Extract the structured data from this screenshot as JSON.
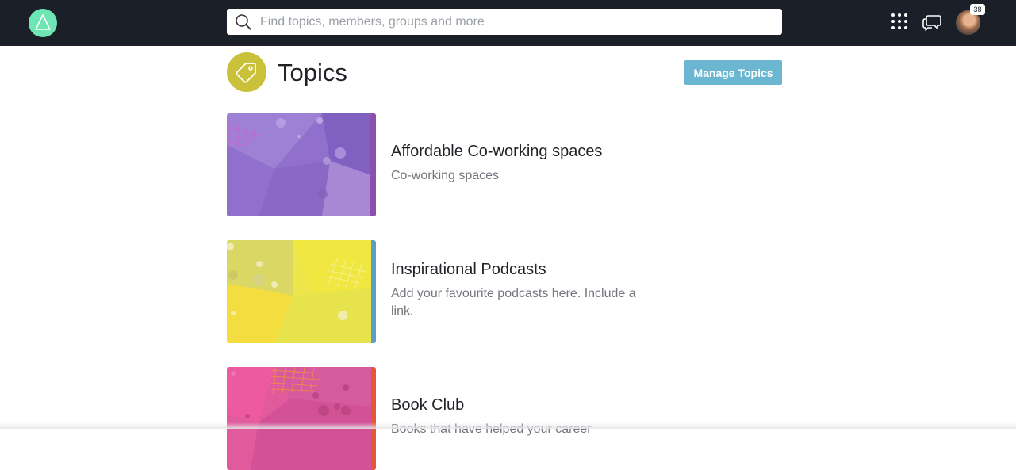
{
  "topbar": {
    "search_placeholder": "Find topics, members, groups and more",
    "notification_count": "38",
    "icons": [
      "logo-triangle-icon",
      "search-icon",
      "apps-grid-icon",
      "chat-icon",
      "avatar"
    ],
    "colors": {
      "bar": "#1b1f27",
      "logo": "#6ee6b3"
    }
  },
  "header": {
    "title": "Topics",
    "icon": "tag-icon",
    "manage_label": "Manage Topics",
    "colors": {
      "icon_bg": "#c9c13a",
      "button": "#6bb6d0"
    }
  },
  "topics": [
    {
      "name": "Affordable Co-working spaces",
      "description": "Co-working spaces",
      "theme": "purple"
    },
    {
      "name": "Inspirational Podcasts",
      "description": "Add your favourite podcasts here. Include a link.",
      "theme": "yellow"
    },
    {
      "name": "Book Club",
      "description": "Books that have helped your career",
      "theme": "pink"
    }
  ]
}
